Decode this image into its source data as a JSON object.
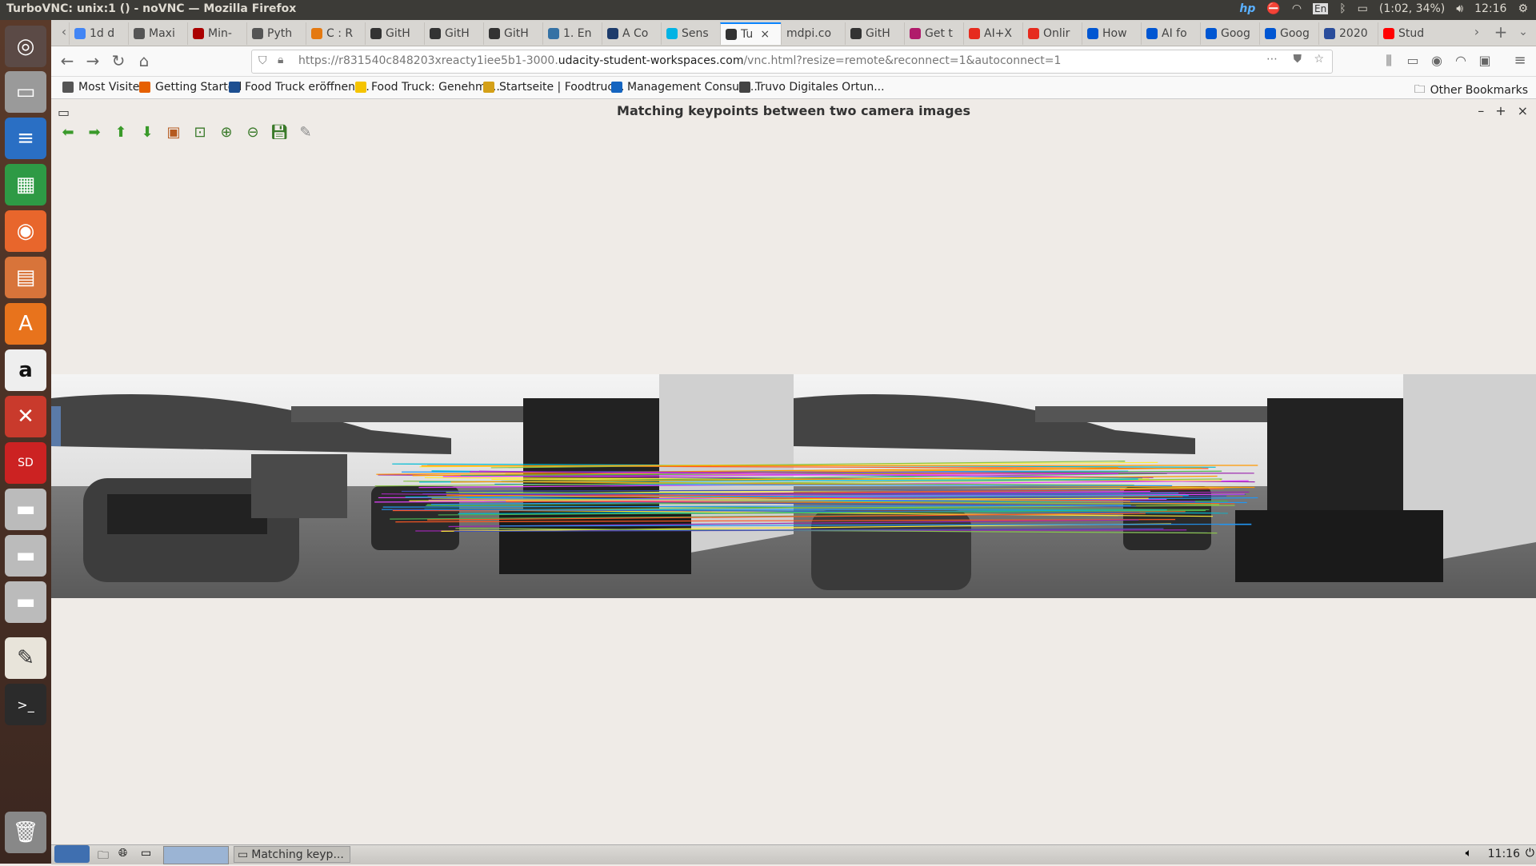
{
  "system": {
    "window_title": "TurboVNC: unix:1 () - noVNC — Mozilla Firefox",
    "battery": "(1:02, 34%)",
    "clock": "12:16"
  },
  "tabs": [
    {
      "label": "1d d",
      "color": "#4285f4"
    },
    {
      "label": "Maxi",
      "color": "#555"
    },
    {
      "label": "Min-",
      "color": "#a00"
    },
    {
      "label": "Pyth",
      "color": "#555"
    },
    {
      "label": "C : R",
      "color": "#e47911"
    },
    {
      "label": "GitH",
      "color": "#333"
    },
    {
      "label": "GitH",
      "color": "#333"
    },
    {
      "label": "GitH",
      "color": "#333"
    },
    {
      "label": "1. En",
      "color": "#3572a5"
    },
    {
      "label": "A Co",
      "color": "#1d3b6b"
    },
    {
      "label": "Sens",
      "color": "#02b3e4"
    },
    {
      "label": "Tu",
      "color": "#333",
      "active": true
    },
    {
      "label": "mdpi.co",
      "color": ""
    },
    {
      "label": "GitH",
      "color": "#333"
    },
    {
      "label": "Get t",
      "color": "#b01b6b"
    },
    {
      "label": "AI+X",
      "color": "#e62b1e"
    },
    {
      "label": "Onlir",
      "color": "#e62b1e"
    },
    {
      "label": "How",
      "color": "#0056d2"
    },
    {
      "label": "AI fo",
      "color": "#0056d2"
    },
    {
      "label": "Goog",
      "color": "#0056d2"
    },
    {
      "label": "Goog",
      "color": "#0056d2"
    },
    {
      "label": "2020",
      "color": "#2a4d9b"
    },
    {
      "label": "Stud",
      "color": "#ff0000"
    }
  ],
  "url": {
    "prefix": "https://r831540c848203xreacty1iee5b1-3000.",
    "domain": "udacity-student-workspaces.com",
    "suffix": "/vnc.html?resize=remote&reconnect=1&autoconnect=1"
  },
  "bookmarks": [
    {
      "label": "Most Visited",
      "color": "#555"
    },
    {
      "label": "Getting Started",
      "color": "#e66000"
    },
    {
      "label": "Food Truck eröffnen ...",
      "color": "#1d4f91"
    },
    {
      "label": "Food Truck: Genehmi...",
      "color": "#f5c400"
    },
    {
      "label": "Startseite | Foodtruc...",
      "color": "#d4a017"
    },
    {
      "label": "Management Consult...",
      "color": "#1565c0"
    },
    {
      "label": "Truvo Digitales Ortun...",
      "color": "#444"
    }
  ],
  "other_bookmarks": "Other Bookmarks",
  "app": {
    "title": "Matching keypoints between two camera images"
  },
  "toolbar_icons": [
    "back-arrow-icon",
    "forward-arrow-icon",
    "up-arrow-icon",
    "down-arrow-icon",
    "image-icon",
    "zoom-fit-icon",
    "zoom-in-icon",
    "zoom-out-icon",
    "save-icon",
    "settings-icon"
  ],
  "taskbar": {
    "task_label": "Matching keyp...",
    "time": "11:16"
  }
}
